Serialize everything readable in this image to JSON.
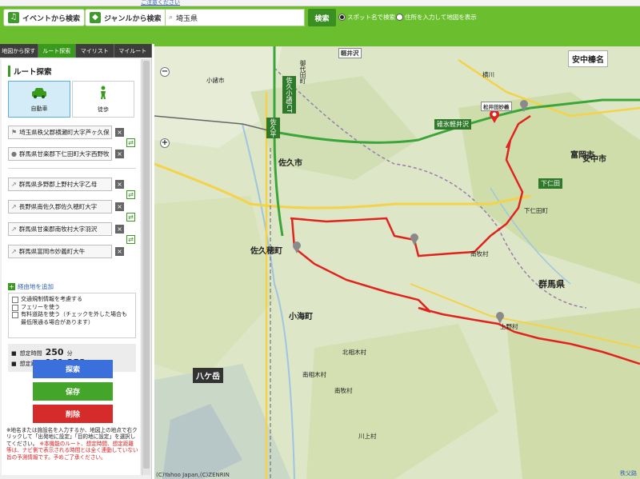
{
  "top": {
    "strip_link": "ご注意ください",
    "event_btn": "イベントから検索",
    "genre_btn": "ジャンルから検索",
    "search_value": "埼玉県",
    "search_btn": "検索",
    "radio_spot": "スポット名で検索",
    "radio_addr": "住所を入力して地図を表示"
  },
  "sidebar": {
    "tabs": [
      "地図から探す",
      "ルート探索",
      "マイリスト",
      "マイルート"
    ],
    "title": "ルート探索",
    "mode_car": "自動車",
    "mode_walk": "徒歩",
    "start": "埼玉県秩父郡横瀬町大字芦ヶ久保",
    "goal": "群馬県甘楽郡下仁田町大字西野牧",
    "via": [
      "群馬県多野郡上野村大字乙母",
      "長野県南佐久郡佐久穂町大字",
      "群馬県甘楽郡南牧村大字羽沢",
      "群馬県富岡市妙義町大牛"
    ],
    "add_via": "経由地を追加",
    "options": [
      "交通規制情報を考慮する",
      "フェリーを使う",
      "有料道路を使う（チェックを外した場合も最低限通る場合があります）"
    ],
    "time_label": "想定時間",
    "time_value": "250",
    "time_unit": "分",
    "dist_label": "想定距離",
    "dist_value": "161.353",
    "dist_unit": "km",
    "btn_search": "探索",
    "btn_save": "保存",
    "btn_delete": "削除",
    "note_black": "※地名または施設名を入力するか、地図上の地点で右クリックして「出発地に設定」「目的地に設定」を選択してください。",
    "note_red": "※本機能のルート、想定時間、想定距離等は、ナビ側で表示される時間とは全く連動していない旨の予測情報です。予めご了承ください。"
  },
  "map": {
    "labels": {
      "karuizawa": "軽井沢",
      "annaka": "安中市",
      "saku": "佐久市",
      "sakuho": "佐久穂町",
      "shimonita": "下仁田町",
      "nanmoku": "南牧村",
      "gunma": "群馬県",
      "yatsugatake": "八ケ岳",
      "koumi": "小海町",
      "kitaaiki": "北相木村",
      "minamiaiki": "南相木村",
      "ueno": "上野村",
      "tomioka": "富岡市",
      "myogi": "松井田妙義",
      "komoro": "小諸市",
      "miyota": "御代田町",
      "kawakami": "川上村",
      "minamimaki": "南牧村",
      "shimonita_box": "下仁田",
      "sakudaira": "佐久平",
      "annaka_haruna": "安中榛名",
      "yokokawa": "横川",
      "jcb": "佐久小諸JCT",
      "usui": "碓氷軽井沢",
      "copyright": "(C)Yahoo Japan,(C)ZENRIN",
      "corner": "秩父路"
    },
    "route_color": "#e0231e",
    "green_road_color": "#3aa63a"
  }
}
